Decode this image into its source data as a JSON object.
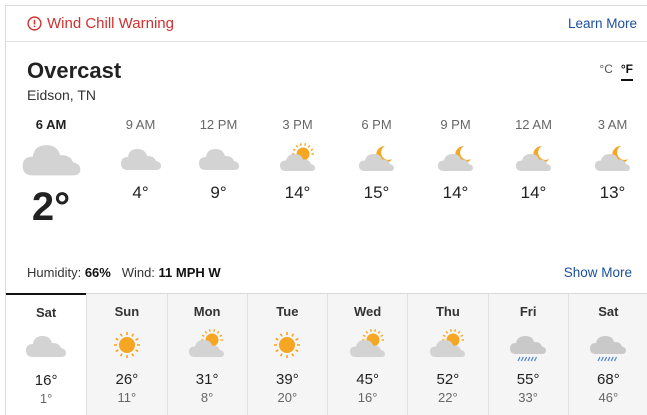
{
  "alert": {
    "title": "Wind Chill Warning",
    "link": "Learn More",
    "icon": "info-circle-icon",
    "color": "#d32f2f"
  },
  "current": {
    "condition": "Overcast",
    "location": "Eidson, TN",
    "units": {
      "c": "°C",
      "f": "°F",
      "selected": "F"
    },
    "humidity_label": "Humidity:",
    "humidity_value": "66%",
    "wind_label": "Wind:",
    "wind_value": "11 MPH W",
    "show_more": "Show More"
  },
  "hourly": [
    {
      "time": "6 AM",
      "temp": "2°",
      "icon": "cloud"
    },
    {
      "time": "9 AM",
      "temp": "4°",
      "icon": "cloud"
    },
    {
      "time": "12 PM",
      "temp": "9°",
      "icon": "cloud"
    },
    {
      "time": "3 PM",
      "temp": "14°",
      "icon": "sun-cloud"
    },
    {
      "time": "6 PM",
      "temp": "15°",
      "icon": "moon-cloud"
    },
    {
      "time": "9 PM",
      "temp": "14°",
      "icon": "moon-cloud"
    },
    {
      "time": "12 AM",
      "temp": "14°",
      "icon": "moon-cloud"
    },
    {
      "time": "3 AM",
      "temp": "13°",
      "icon": "moon-cloud"
    }
  ],
  "daily": [
    {
      "day": "Sat",
      "high": "16°",
      "low": "1°",
      "icon": "cloud"
    },
    {
      "day": "Sun",
      "high": "26°",
      "low": "11°",
      "icon": "sun"
    },
    {
      "day": "Mon",
      "high": "31°",
      "low": "8°",
      "icon": "sun-cloud"
    },
    {
      "day": "Tue",
      "high": "39°",
      "low": "20°",
      "icon": "sun"
    },
    {
      "day": "Wed",
      "high": "45°",
      "low": "16°",
      "icon": "sun-cloud"
    },
    {
      "day": "Thu",
      "high": "52°",
      "low": "22°",
      "icon": "sun-cloud"
    },
    {
      "day": "Fri",
      "high": "55°",
      "low": "33°",
      "icon": "rain"
    },
    {
      "day": "Sat",
      "high": "68°",
      "low": "46°",
      "icon": "rain"
    }
  ]
}
